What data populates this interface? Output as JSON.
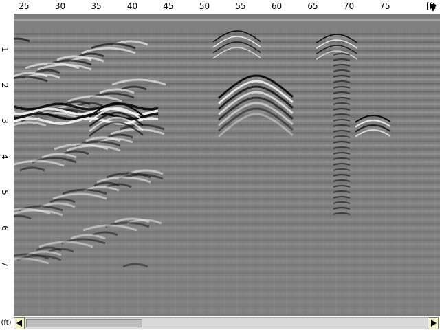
{
  "ruler": {
    "x_unit": "ft",
    "y_unit": "ft",
    "x_ticks": [
      "25",
      "30",
      "35",
      "40",
      "45",
      "50",
      "55",
      "60",
      "65",
      "70",
      "75"
    ],
    "y_ticks": [
      "1",
      "2",
      "3",
      "4",
      "5",
      "6",
      "7"
    ],
    "corner_label": "(ft)"
  },
  "scrollbar": {
    "position_fraction": 0.0,
    "visible_fraction": 0.29
  },
  "colors": {
    "background_gray": "#808080",
    "band_dark": "#000000",
    "band_light": "#ffffff",
    "button_fill": "#f2f2c8"
  }
}
